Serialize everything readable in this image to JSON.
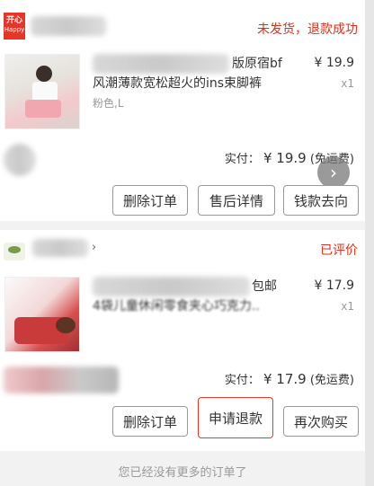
{
  "orders": [
    {
      "shop_logo_text_top": "开心",
      "shop_logo_text_bottom": "Happy",
      "status": "未发货，退款成功",
      "title_line1": "版原宿bf",
      "title_line2": "风潮薄款宽松超火的ins束脚裤",
      "sku": "粉色,L",
      "price": "¥ 19.9",
      "qty": "x1",
      "paid_label": "实付：",
      "paid_amount": "¥ 19.9",
      "shipping": "(免运费)",
      "buttons": [
        "删除订单",
        "售后详情",
        "钱款去向"
      ]
    },
    {
      "status": "已评价",
      "title_line1": "包邮",
      "title_line2": "4袋儿童休闲零食夹心巧克力..",
      "price": "¥ 17.9",
      "qty": "x1",
      "paid_label": "实付：",
      "paid_amount": "¥ 17.9",
      "shipping": "(免运费)",
      "buttons": [
        "删除订单",
        "申请退款",
        "再次购买"
      ]
    }
  ],
  "footer_note": "您已经没有更多的订单了",
  "icons": {
    "next": "chevron-right-icon",
    "shop_arrow": "chevron-right-icon"
  },
  "colors": {
    "accent": "#d4331f",
    "highlight_border": "#e03a2e"
  }
}
